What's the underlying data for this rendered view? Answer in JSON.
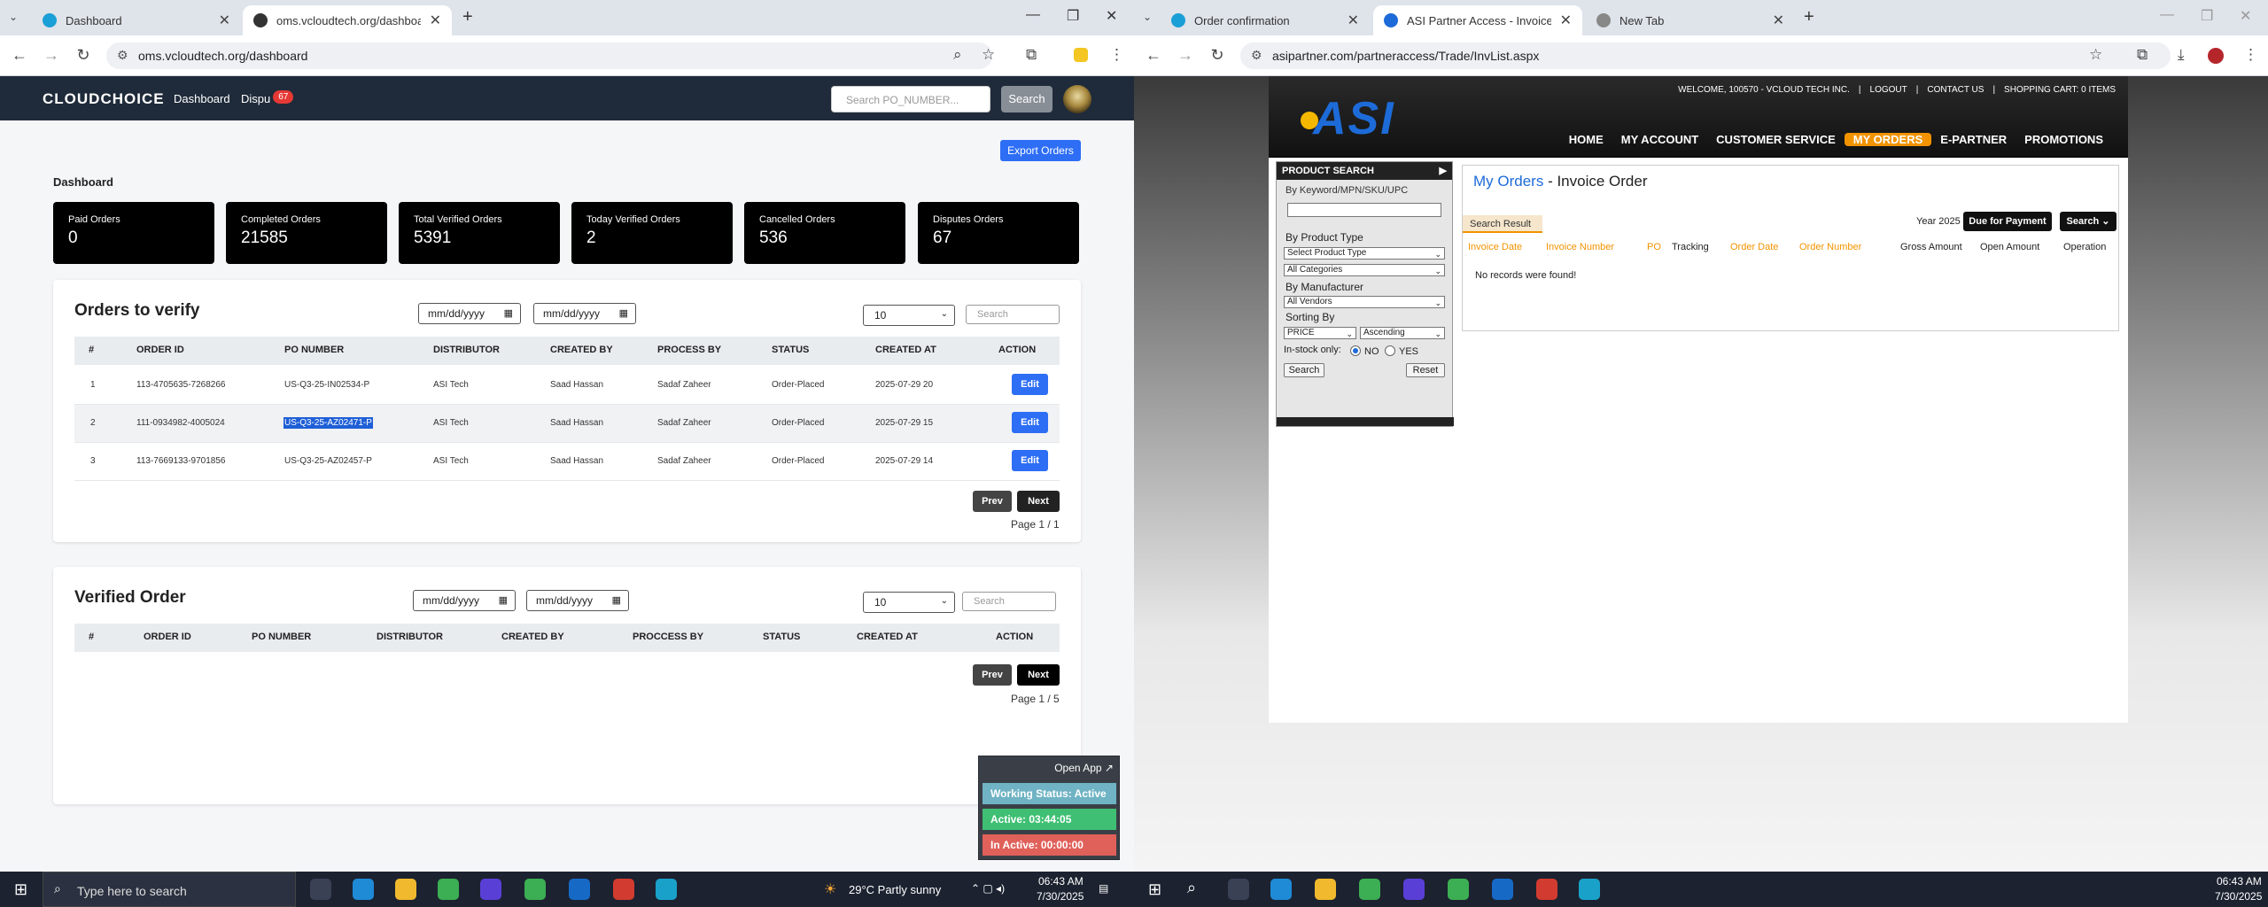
{
  "left_browser": {
    "tabs": [
      {
        "title": "Dashboard",
        "active": false
      },
      {
        "title": "oms.vcloudtech.org/dashboard",
        "active": true
      }
    ],
    "url": "oms.vcloudtech.org/dashboard"
  },
  "oms": {
    "logo": "CLOUDCHOICE",
    "nav": {
      "dashboard": "Dashboard",
      "disputes": "Dispu",
      "disputes_badge": "67"
    },
    "search": {
      "placeholder": "Search PO_NUMBER...",
      "button": "Search"
    },
    "export_label": "Export Orders",
    "dashboard_label": "Dashboard",
    "cards": [
      {
        "label": "Paid Orders",
        "value": "0"
      },
      {
        "label": "Completed Orders",
        "value": "21585"
      },
      {
        "label": "Total Verified Orders",
        "value": "5391"
      },
      {
        "label": "Today Verified Orders",
        "value": "2"
      },
      {
        "label": "Cancelled Orders",
        "value": "536"
      },
      {
        "label": "Disputes Orders",
        "value": "67"
      }
    ],
    "verify": {
      "title": "Orders to verify",
      "date_placeholder": "mm/dd/yyyy",
      "page_size": "10",
      "search_placeholder": "Search",
      "headers": [
        "#",
        "ORDER ID",
        "PO NUMBER",
        "DISTRIBUTOR",
        "CREATED BY",
        "PROCESS BY",
        "STATUS",
        "CREATED AT",
        "ACTION"
      ],
      "rows": [
        {
          "n": "1",
          "order_id": "113-4705635-7268266",
          "po": "US-Q3-25-IN02534-P",
          "distributor": "ASI Tech",
          "created_by": "Saad Hassan",
          "process_by": "Sadaf Zaheer",
          "status": "Order-Placed",
          "created_at": "2025-07-29 20",
          "action": "Edit"
        },
        {
          "n": "2",
          "order_id": "111-0934982-4005024",
          "po": "US-Q3-25-AZ02471-P",
          "distributor": "ASI Tech",
          "created_by": "Saad Hassan",
          "process_by": "Sadaf Zaheer",
          "status": "Order-Placed",
          "created_at": "2025-07-29 15",
          "action": "Edit"
        },
        {
          "n": "3",
          "order_id": "113-7669133-9701856",
          "po": "US-Q3-25-AZ02457-P",
          "distributor": "ASI Tech",
          "created_by": "Saad Hassan",
          "process_by": "Sadaf Zaheer",
          "status": "Order-Placed",
          "created_at": "2025-07-29 14",
          "action": "Edit"
        }
      ],
      "prev": "Prev",
      "next": "Next",
      "page": "Page 1 / 1"
    },
    "verified": {
      "title": "Verified Order",
      "date_placeholder": "mm/dd/yyyy",
      "page_size": "10",
      "search_placeholder": "Search",
      "headers": [
        "#",
        "ORDER ID",
        "PO NUMBER",
        "DISTRIBUTOR",
        "CREATED BY",
        "PROCCESS BY",
        "STATUS",
        "CREATED AT",
        "ACTION"
      ],
      "prev": "Prev",
      "next": "Next",
      "page": "Page 1 / 5"
    },
    "tracker": {
      "open_app": "Open App ↗",
      "working": "Working Status: Active",
      "active": "Active: 03:44:05",
      "inactive": "In Active: 00:00:00",
      "colors": {
        "working": "#6fb3c4",
        "active": "#3fbf73",
        "inactive": "#e0605a"
      }
    }
  },
  "right_browser": {
    "tabs": [
      {
        "title": "Order confirmation",
        "active": false
      },
      {
        "title": "ASI Partner Access - Invoice His",
        "active": true
      },
      {
        "title": "New Tab",
        "active": false
      }
    ],
    "url": "asipartner.com/partneraccess/Trade/InvList.aspx"
  },
  "asi": {
    "logo": "ASI",
    "top_links": [
      "WELCOME, 100570 - VCLOUD TECH INC.",
      "LOGOUT",
      "CONTACT US",
      "SHOPPING CART: 0 ITEMS"
    ],
    "nav": [
      "HOME",
      "MY ACCOUNT",
      "CUSTOMER SERVICE",
      "MY ORDERS",
      "E-PARTNER",
      "PROMOTIONS"
    ],
    "side": {
      "title": "PRODUCT SEARCH",
      "keyword_label": "By Keyword/MPN/SKU/UPC",
      "product_type_label": "By Product Type",
      "product_type_value": "Select Product Type",
      "categories_value": "All Categories",
      "manufacturer_label": "By Manufacturer",
      "vendors_value": "All Vendors",
      "sorting_label": "Sorting By",
      "sort_field": "PRICE",
      "sort_order": "Ascending",
      "instock_label": "In-stock only:",
      "no": "NO",
      "yes": "YES",
      "search": "Search",
      "reset": "Reset"
    },
    "main": {
      "title_blue": "My Orders",
      "title_rest": " - Invoice Order",
      "tab": "Search Result",
      "year": "Year 2025",
      "due_button": "Due for Payment",
      "search_button": "Search",
      "columns": [
        "Invoice Date",
        "Invoice Number",
        "PO",
        "Tracking",
        "Order Date",
        "Order Number",
        "Gross Amount",
        "Open Amount",
        "Operation"
      ],
      "empty": "No records were found!"
    }
  },
  "taskbar_left": {
    "search": "Type here to search",
    "weather": "29°C  Partly sunny",
    "time": "06:43 AM",
    "date": "7/30/2025"
  },
  "taskbar_right": {
    "time": "06:43 AM",
    "date": "7/30/2025"
  }
}
